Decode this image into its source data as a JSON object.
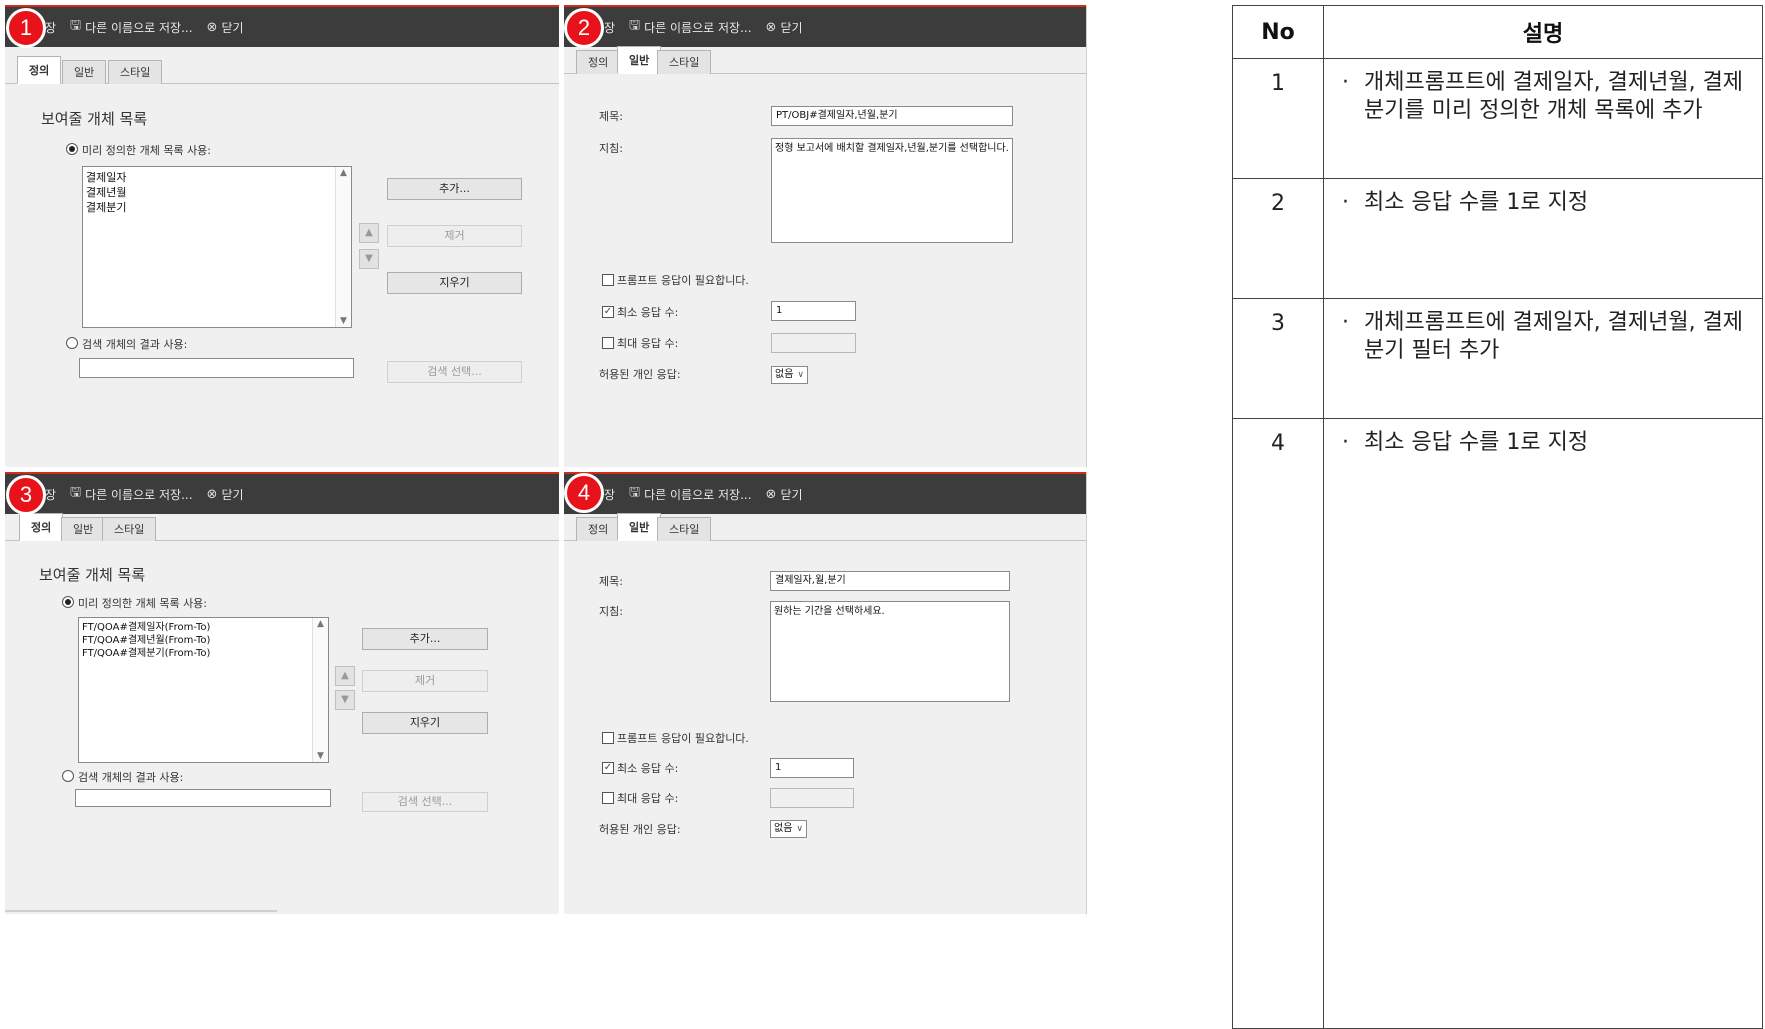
{
  "toolbar": {
    "save_as": "다른 이름으로 저장...",
    "close": "닫기",
    "save_fragment": "장"
  },
  "tabs": [
    "정의",
    "일반",
    "스타일"
  ],
  "panel1": {
    "badge": "1",
    "heading": "보여줄 개체 목록",
    "predefined_label": "미리 정의한 개체 목록 사용:",
    "list_items": "결제일자\n결제년월\n결제분기",
    "add_button": "추가...",
    "remove_button": "제거",
    "clear_button": "지우기",
    "search_label": "검색 개체의 결과 사용:",
    "search_select_button": "검색 선택..."
  },
  "panel2": {
    "badge": "2",
    "title_label": "제목:",
    "title_value": "PT/OBJ#결제일자,년월,분기",
    "guide_label": "지침:",
    "guide_value": "정형 보고서에 배치할 결제일자,년월,분기를 선택합니다.",
    "required_label": "프롬프트 응답이 필요합니다.",
    "min_label": "최소 응답 수:",
    "min_value": "1",
    "max_label": "최대 응답 수:",
    "allowed_label": "허용된 개인 응답:",
    "allowed_value": "없음"
  },
  "panel3": {
    "badge": "3",
    "heading": "보여줄 개체 목록",
    "predefined_label": "미리 정의한 개체 목록 사용:",
    "list_items": "FT/QOA#결제일자(From-To)\nFT/QOA#결제년월(From-To)\nFT/QOA#결제분기(From-To)",
    "add_button": "추가...",
    "remove_button": "제거",
    "clear_button": "지우기",
    "search_label": "검색 개체의 결과 사용:",
    "search_select_button": "검색 선택..."
  },
  "panel4": {
    "badge": "4",
    "title_label": "제목:",
    "title_value": "결제일자,월,분기",
    "guide_label": "지침:",
    "guide_value": "원하는 기간을 선택하세요.",
    "required_label": "프롬프트 응답이 필요합니다.",
    "min_label": "최소 응답 수:",
    "min_value": "1",
    "max_label": "최대 응답 수:",
    "allowed_label": "허용된 개인 응답:",
    "allowed_value": "없음"
  },
  "table": {
    "header_no": "No",
    "header_desc": "설명",
    "rows": [
      {
        "no": "1",
        "text": "개체프롬프트에 결제일자, 결제년월, 결제분기를 미리 정의한 개체 목록에 추가"
      },
      {
        "no": "2",
        "text": "최소 응답 수를 1로 지정"
      },
      {
        "no": "3",
        "text": "개체프롬프트에 결제일자, 결제년월, 결제분기 필터 추가"
      },
      {
        "no": "4",
        "text": "최소 응답 수를 1로 지정"
      }
    ],
    "bullet": "·"
  },
  "colors": {
    "badge": "#e8121b",
    "toolbar": "#3c3c3c",
    "toolbar_accent": "#d52b1e"
  }
}
